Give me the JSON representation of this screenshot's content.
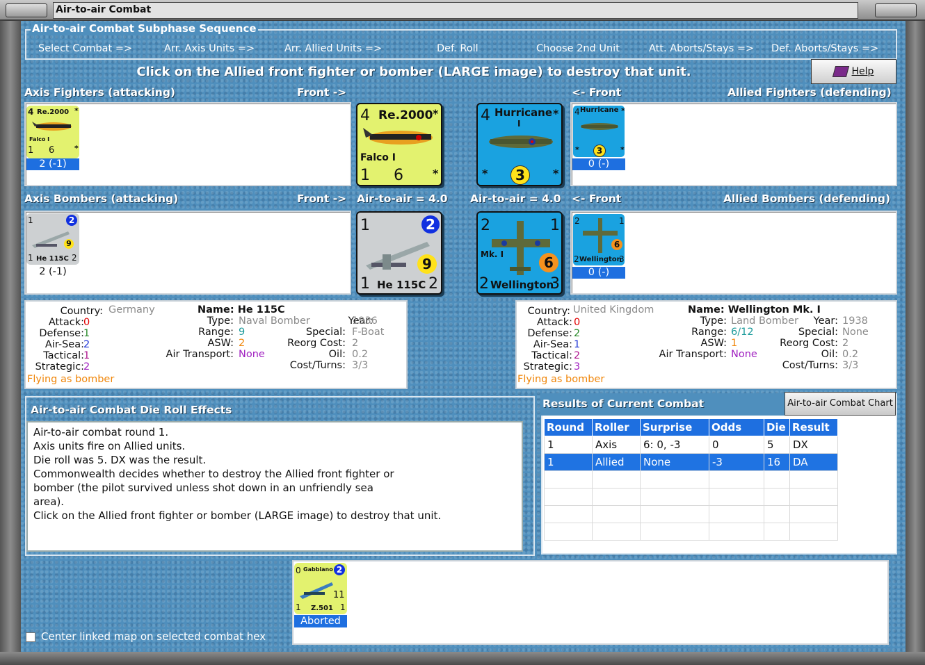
{
  "window": {
    "title": "Air-to-air Combat"
  },
  "sequence": {
    "legend": "Air-to-air Combat Subphase Sequence",
    "steps": [
      "Select Combat =>",
      "Arr. Axis Units =>",
      "Arr. Allied Units =>",
      "Def. Roll",
      "Choose 2nd Unit",
      "Att. Aborts/Stays =>",
      "Def. Aborts/Stays =>"
    ]
  },
  "instruction": "Click on the Allied front fighter or bomber (LARGE image) to destroy that unit.",
  "help_button": {
    "label": "Help",
    "icon": "help-book-icon"
  },
  "fighters": {
    "axis_title": "Axis Fighters (attacking)",
    "axis_front": "Front ->",
    "allied_front": "<- Front",
    "allied_title": "Allied Fighters (defending)"
  },
  "bombers": {
    "axis_title": "Axis Bombers (attacking)",
    "axis_front": "Front ->",
    "axis_air": "Air-to-air = 4.0",
    "allied_air": "Air-to-air = 4.0",
    "allied_front": "<- Front",
    "allied_title": "Allied Bombers (defending)"
  },
  "units": {
    "re2000": {
      "air": "4",
      "name": "Re.2000",
      "star": "*",
      "sub": "Falco I",
      "def": "1",
      "range": "6",
      "caption": "2 (-1)",
      "color": "#e3f26f"
    },
    "hurricane": {
      "air": "4",
      "name": "Hurricane",
      "sub": "I",
      "star": "*",
      "range": "3",
      "caption": "0 (-)",
      "color": "#1aa2e0"
    },
    "he115": {
      "top": "1",
      "tac": "2",
      "range": "9",
      "def": "1",
      "name": "He 115C",
      "strat": "2",
      "caption": "2 (-1)",
      "color": "#cdd0d2"
    },
    "wellington": {
      "top": "2",
      "tac": "1",
      "mk": "Mk. I",
      "range": "6",
      "def": "2",
      "name": "Wellington",
      "strat": "3",
      "caption": "0 (-)",
      "color": "#1aa2e0"
    },
    "gabbiano": {
      "top": "0",
      "name_top": "Gabbiano",
      "tac": "2",
      "range": "11",
      "def": "1",
      "name": "Z.501",
      "strat": "1",
      "caption": "Aborted",
      "color": "#e3f26f"
    }
  },
  "axis_info": {
    "country_label": "Country:",
    "country": "Germany",
    "attack_label": "Attack:",
    "attack": "0",
    "defense_label": "Defense:",
    "defense": "1",
    "airsea_label": "Air-Sea:",
    "airsea": "2",
    "tactical_label": "Tactical:",
    "tactical": "1",
    "strategic_label": "Strategic:",
    "strategic": "2",
    "flying": "Flying as bomber",
    "name_line": "Name: He 115C",
    "type_label": "Type:",
    "type": "Naval Bomber",
    "year_label": "Year:",
    "year": "1936",
    "range_label": "Range:",
    "range": "9",
    "special_label": "Special:",
    "special": "F-Boat",
    "asw_label": "ASW:",
    "asw": "2",
    "reorg_label": "Reorg Cost:",
    "reorg": "2",
    "transport_label": "Air Transport:",
    "transport": "None",
    "oil_label": "Oil:",
    "oil": "0.2",
    "cost_label": "Cost/Turns:",
    "cost": "3/3"
  },
  "allied_info": {
    "country_label": "Country:",
    "country": "United Kingdom",
    "attack_label": "Attack:",
    "attack": "0",
    "defense_label": "Defense:",
    "defense": "2",
    "airsea_label": "Air-Sea:",
    "airsea": "1",
    "tactical_label": "Tactical:",
    "tactical": "2",
    "strategic_label": "Strategic:",
    "strategic": "3",
    "flying": "Flying as bomber",
    "name_line": "Name: Wellington Mk. I",
    "type_label": "Type:",
    "type": "Land Bomber",
    "year_label": "Year:",
    "year": "1938",
    "range_label": "Range:",
    "range": "6/12",
    "special_label": "Special:",
    "special": "None",
    "asw_label": "ASW:",
    "asw": "1",
    "reorg_label": "Reorg Cost:",
    "reorg": "2",
    "transport_label": "Air Transport:",
    "transport": "None",
    "oil_label": "Oil:",
    "oil": "0.2",
    "cost_label": "Cost/Turns:",
    "cost": "3/3"
  },
  "die_roll": {
    "title": "Air-to-air Combat Die Roll Effects",
    "lines": [
      "Air-to-air combat round 1.",
      "Axis units fire on Allied units.",
      "Die roll was 5.  DX was the result.",
      "Commonwealth decides whether to destroy the Allied front fighter or",
      "bomber (the pilot survived unless shot down in an unfriendly sea",
      "area).",
      "Click on the Allied front fighter or bomber (LARGE image) to destroy that unit."
    ]
  },
  "results": {
    "title": "Results of Current Combat",
    "chart_button": "Air-to-air Combat Chart",
    "columns": [
      "Round",
      "Roller",
      "Surprise",
      "Odds",
      "Die",
      "Result"
    ],
    "rows": [
      [
        "1",
        "Axis",
        "6: 0, -3",
        "0",
        "5",
        "DX"
      ],
      [
        "1",
        "Allied",
        "None",
        "-3",
        "16",
        "DA"
      ]
    ]
  },
  "center_map": {
    "label": "Center linked map on selected combat hex",
    "checked": false
  }
}
